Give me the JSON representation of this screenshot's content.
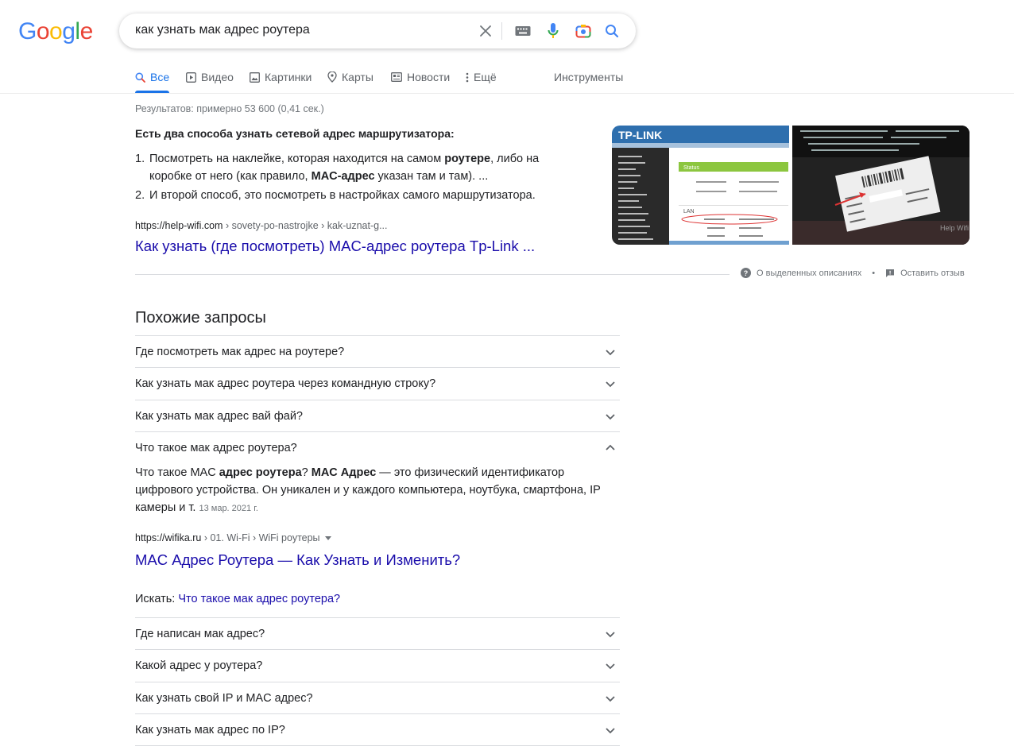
{
  "logo": {
    "text": "Google",
    "letters": [
      "G",
      "o",
      "o",
      "g",
      "l",
      "e"
    ],
    "colors": [
      "#4285f4",
      "#ea4335",
      "#fbbc05",
      "#4285f4",
      "#34a853",
      "#ea4335"
    ]
  },
  "search": {
    "value": "как узнать мак адрес роутера"
  },
  "tabs": [
    {
      "label": "Все",
      "icon": "search-icon",
      "active": true
    },
    {
      "label": "Видео",
      "icon": "play-icon"
    },
    {
      "label": "Картинки",
      "icon": "image-icon"
    },
    {
      "label": "Карты",
      "icon": "map-pin-icon"
    },
    {
      "label": "Новости",
      "icon": "news-icon"
    },
    {
      "label": "Ещё",
      "icon": "more-vert-icon"
    }
  ],
  "tools_label": "Инструменты",
  "results_count": "Результатов: примерно 53 600 (0,41 сек.)",
  "featured_snippet": {
    "title": "Есть два способа узнать сетевой адрес маршрутизатора:",
    "items": [
      {
        "num": "1.",
        "parts": [
          "Посмотреть на наклейке, которая находится на самом ",
          "роутере",
          ", либо на коробке от него (как правило, ",
          "MAC-адрес",
          " указан там и там). ..."
        ]
      },
      {
        "num": "2.",
        "parts": [
          "И второй способ, это посмотреть в настройках самого маршрутизатора."
        ]
      }
    ],
    "cite_domain": "https://help-wifi.com",
    "cite_path": " › sovety-po-nastrojke › kak-uznat-g...",
    "link": "Как узнать (где посмотреть) MAC-адрес роутера Tp-Link ...",
    "images": {
      "brand": "TP-LINK",
      "status": "Status",
      "lan": "LAN",
      "watermark": "Help Wifi"
    },
    "footer_about": "О выделенных описаниях",
    "footer_feedback": "Оставить отзыв"
  },
  "related": {
    "title": "Похожие запросы",
    "questions_top": [
      "Где посмотреть мак адрес на роутере?",
      "Как узнать мак адрес роутера через командную строку?",
      "Как узнать мак адрес вай фай?",
      "Что такое мак адрес роутера?"
    ],
    "answer": {
      "parts": [
        "Что такое MAC ",
        "адрес роутера",
        "? ",
        "MAC Адрес",
        " — это физический идентификатор цифрового устройства. Он уникален и у каждого компьютера, ноутбука, смартфона, IP камеры и т."
      ],
      "date": "13 мар. 2021 г.",
      "cite_domain": "https://wifika.ru",
      "cite_path": " › 01. Wi-Fi › WiFi роутеры",
      "link": "MAC Адрес Роутера — Как Узнать и Изменить?",
      "search_for_label": "Искать: ",
      "search_for_link": "Что такое мак адрес роутера?"
    },
    "questions_bottom": [
      "Где написан мак адрес?",
      "Какой адрес у роутера?",
      "Как узнать свой IP и MAC адрес?",
      "Как узнать мак адрес по IP?"
    ]
  }
}
